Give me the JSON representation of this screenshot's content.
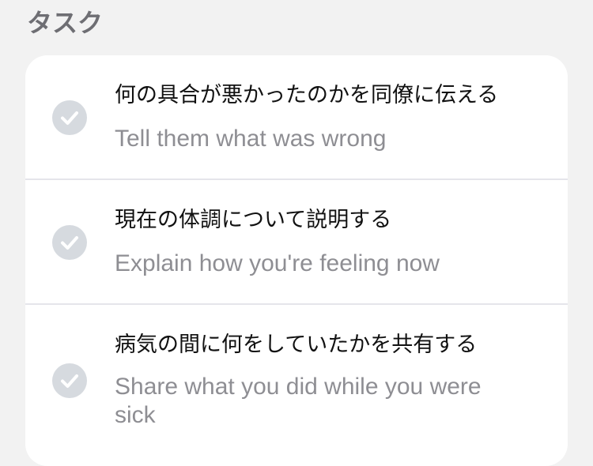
{
  "section": {
    "title": "タスク"
  },
  "tasks": [
    {
      "title": "何の具合が悪かったのかを同僚に伝える",
      "subtitle": "Tell them what was wrong",
      "icon": "checkmark-circle-icon",
      "completed": true
    },
    {
      "title": "現在の体調について説明する",
      "subtitle": "Explain how you're feeling now",
      "icon": "checkmark-circle-icon",
      "completed": true
    },
    {
      "title": "病気の間に何をしていたかを共有する",
      "subtitle": "Share what you did while you were sick",
      "icon": "checkmark-circle-icon",
      "completed": true
    }
  ],
  "colors": {
    "background": "#f2f2f2",
    "card": "#ffffff",
    "check_circle": "#d6dadf",
    "check_mark": "#ffffff",
    "title_text": "#111111",
    "subtitle_text": "#8e8e93",
    "section_title": "#6e6e73",
    "divider": "#e5e5ea"
  }
}
